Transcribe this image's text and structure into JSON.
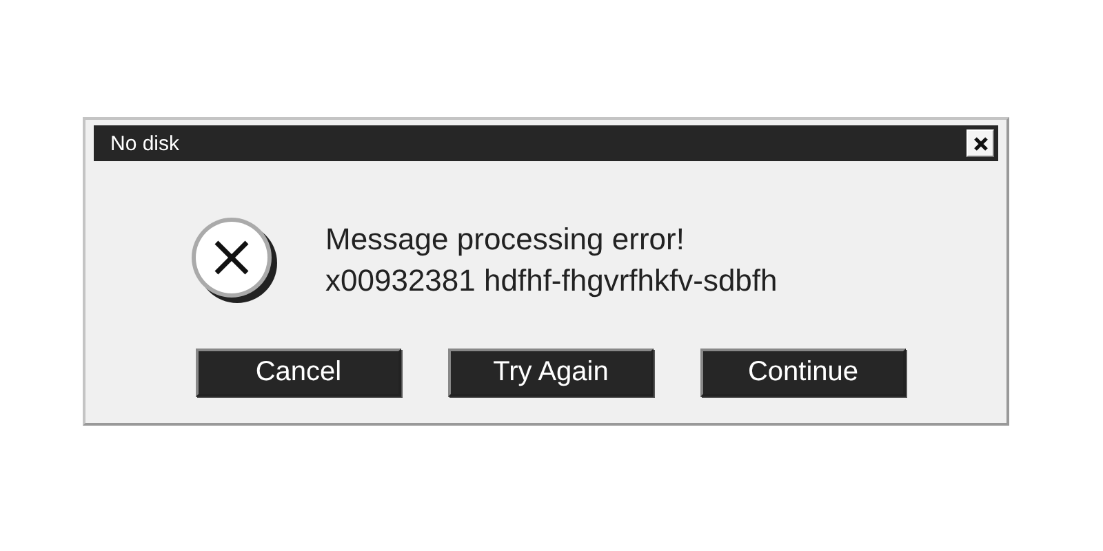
{
  "window": {
    "title": "No disk"
  },
  "message": {
    "lines": [
      "Message processing error!",
      "x00932381 hdfhf-fhgvrfhkfv-sdbfh"
    ]
  },
  "buttons": [
    {
      "label": "Cancel"
    },
    {
      "label": "Try Again"
    },
    {
      "label": "Continue"
    }
  ]
}
